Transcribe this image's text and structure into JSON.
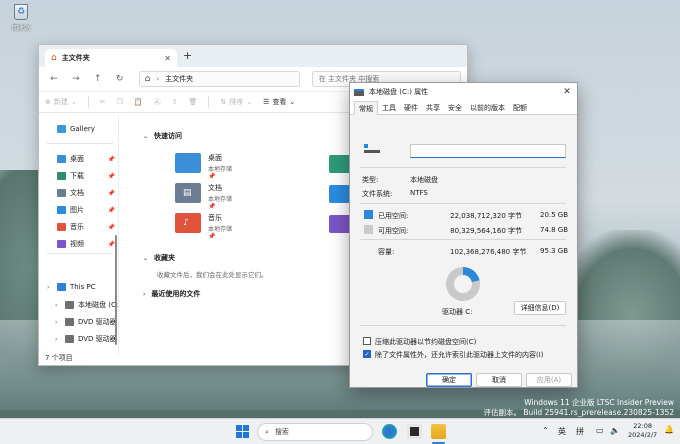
{
  "desktop": {
    "icon_label": "回收站"
  },
  "explorer": {
    "tab_title": "主文件夹",
    "address": "主文件夹",
    "search_placeholder": "在 主文件夹 中搜索",
    "commands": {
      "new": "新建",
      "sort": "排序",
      "view": "查看"
    },
    "sidebar": {
      "gallery": "Gallery",
      "pinned": [
        {
          "label": "桌面",
          "color": "#3b8fd6"
        },
        {
          "label": "下载",
          "color": "#2e8b6f"
        },
        {
          "label": "文档",
          "color": "#6b7d92"
        },
        {
          "label": "图片",
          "color": "#2a8de0"
        },
        {
          "label": "音乐",
          "color": "#e0523a"
        },
        {
          "label": "视频",
          "color": "#7c56c7"
        }
      ],
      "this_pc": "This PC",
      "drives": [
        {
          "label": "本地磁盘 (C:)"
        },
        {
          "label": "DVD 驱动器 (E:"
        },
        {
          "label": "DVD 驱动器 (D:"
        }
      ]
    },
    "sections": {
      "quick_access": "快速访问",
      "favorites": "收藏夹",
      "favorites_desc": "收藏文件后，我们会在此处显示它们。",
      "recent": "最近使用的文件"
    },
    "quick_items": [
      {
        "name": "桌面",
        "sub": "本地存储",
        "color": "#3b8fd6"
      },
      {
        "name": "文档",
        "sub": "本地存储",
        "color": "#6b7d92"
      },
      {
        "name": "音乐",
        "sub": "本地存储",
        "color": "#e0523a"
      }
    ],
    "status": "7 个项目"
  },
  "dialog": {
    "title": "本地磁盘 (C:) 属性",
    "tabs": [
      "常规",
      "工具",
      "硬件",
      "共享",
      "安全",
      "以前的版本",
      "配额"
    ],
    "active_tab": "常规",
    "drive_name_value": "",
    "type_label": "类型:",
    "type_value": "本地磁盘",
    "fs_label": "文件系统:",
    "fs_value": "NTFS",
    "used_label": "已用空间:",
    "used_bytes": "22,038,712,320 字节",
    "used_size": "20.5 GB",
    "free_label": "可用空间:",
    "free_bytes": "80,329,564,160 字节",
    "free_size": "74.8 GB",
    "capacity_label": "容量:",
    "capacity_bytes": "102,368,276,480 字节",
    "capacity_size": "95.3 GB",
    "used_fraction": 0.215,
    "colors": {
      "used": "#2b88d8",
      "free": "#c9c9c9"
    },
    "drive_label": "驱动器 C:",
    "details_button": "详细信息(D)",
    "compress_label": "压缩此驱动器以节约磁盘空间(C)",
    "compress_checked": false,
    "index_label": "除了文件属性外，还允许索引此驱动器上文件的内容(I)",
    "index_checked": true,
    "ok": "确定",
    "cancel": "取消",
    "apply": "应用(A)"
  },
  "watermark": {
    "line1": "Windows 11 企业版 LTSC Insider Preview",
    "line2": "评估副本。 Build 25941.rs_prerelease.230825-1352"
  },
  "taskbar": {
    "search_label": "搜索",
    "ime": "英",
    "ime2": "拼",
    "time": "22:08",
    "date": "2024/2/7"
  }
}
